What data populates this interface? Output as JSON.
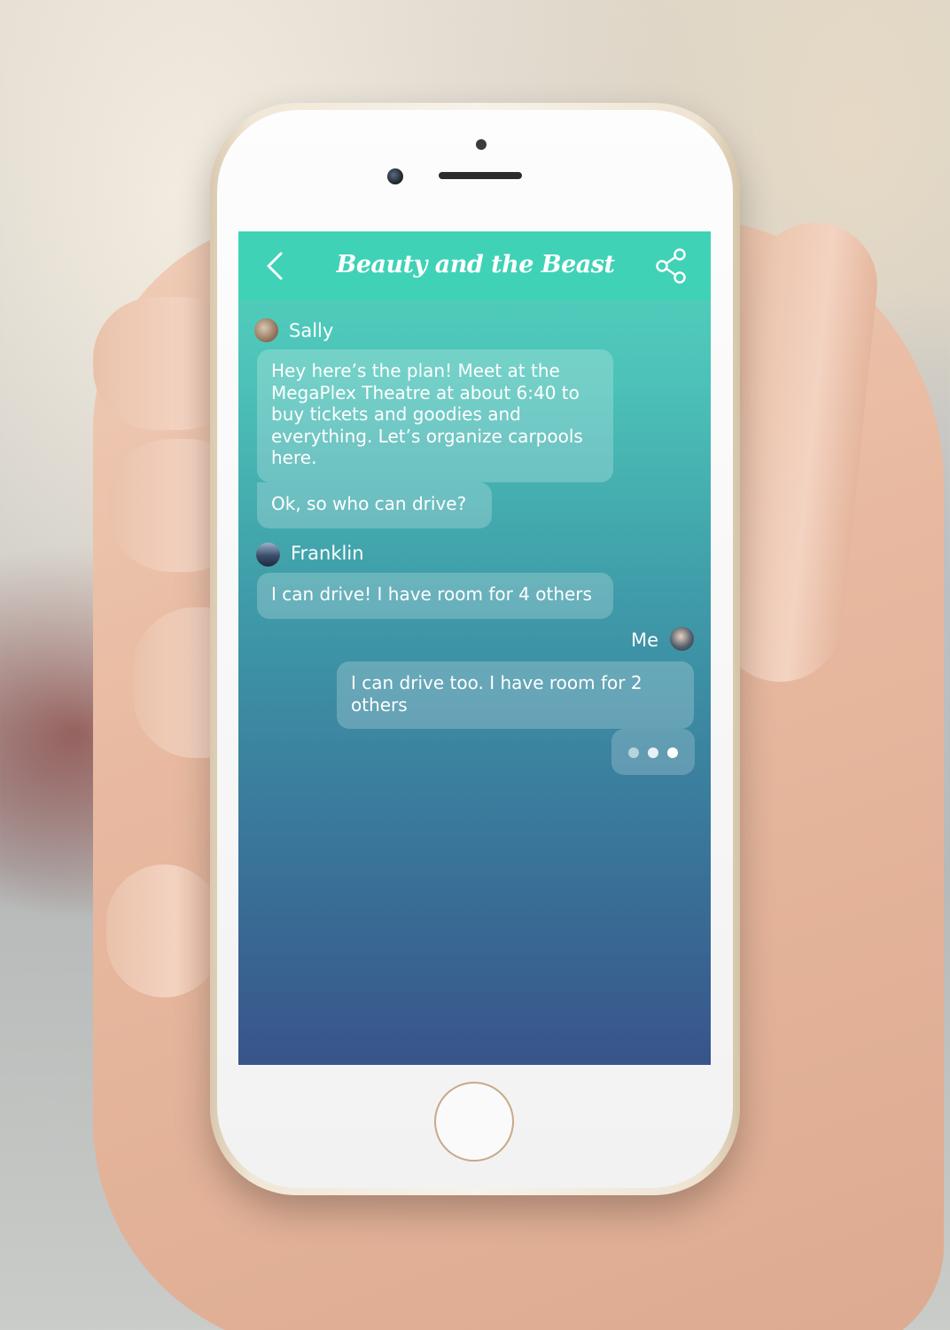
{
  "app": {
    "title": "Beauty and the Beast",
    "back_icon": "chevron-left-icon",
    "share_icon": "share-icon"
  },
  "messages": [
    {
      "sender": "Sally",
      "text": "Hey here’s the plan! Meet at the MegaPlex Theatre at about 6:40 to buy tickets and goodies and everything. Let’s organize carpools here."
    },
    {
      "sender": "Sally",
      "text": "Ok, so who can drive?"
    },
    {
      "sender": "Franklin",
      "text": "I can drive! I have room for 4 others"
    },
    {
      "sender": "Me",
      "text": "I can drive too. I have room for 2 others"
    }
  ],
  "senders": {
    "sally": "Sally",
    "franklin": "Franklin",
    "me": "Me"
  },
  "typing_indicator": "typing-dots-icon",
  "colors": {
    "header": "#3fd2b6",
    "gradient_top": "#52d3bd",
    "gradient_bottom": "#38548a",
    "bubble": "rgba(255,255,255,0.22)",
    "text": "#ffffff"
  }
}
